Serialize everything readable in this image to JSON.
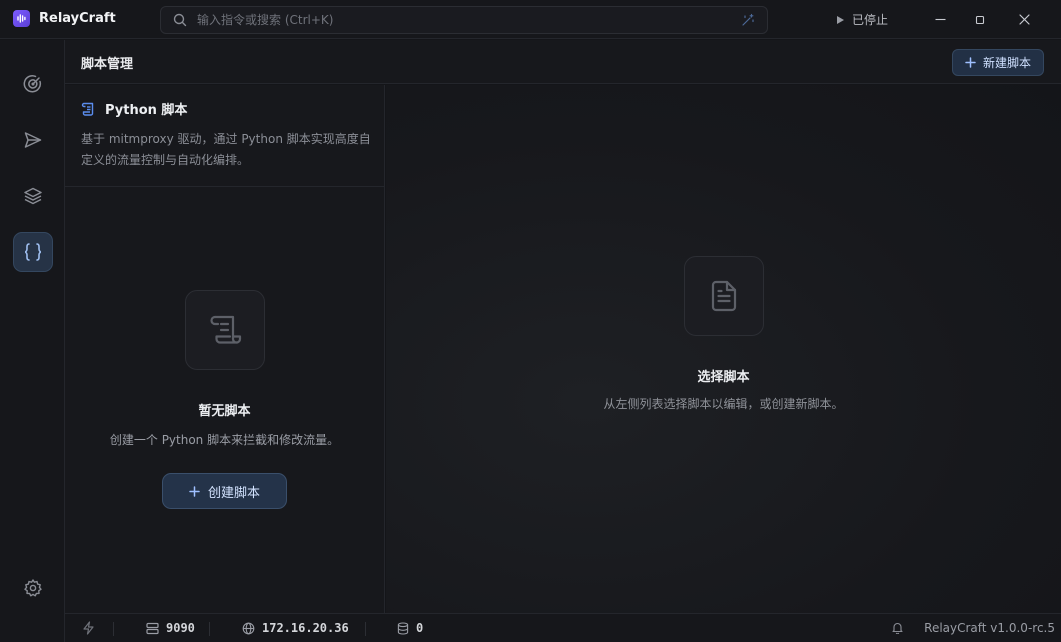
{
  "app": {
    "name": "RelayCraft"
  },
  "search": {
    "placeholder": "输入指令或搜索 (Ctrl+K)"
  },
  "proxy_status": {
    "label": "已停止"
  },
  "header": {
    "title": "脚本管理",
    "new_button": "新建脚本"
  },
  "script_panel": {
    "title": "Python 脚本",
    "description": "基于 mitmproxy 驱动，通过 Python 脚本实现高度自定义的流量控制与自动化编排。",
    "empty_title": "暂无脚本",
    "empty_desc": "创建一个 Python 脚本来拦截和修改流量。",
    "create_button": "创建脚本"
  },
  "detail_panel": {
    "empty_title": "选择脚本",
    "empty_desc": "从左侧列表选择脚本以编辑，或创建新脚本。"
  },
  "statusbar": {
    "port": "9090",
    "ip": "172.16.20.36",
    "count": "0",
    "version": "RelayCraft v1.0.0-rc.5"
  },
  "icons": {
    "brand": "audio-wave-icon",
    "nav": [
      "radar-icon",
      "send-icon",
      "layers-icon",
      "braces-icon",
      "settings-icon"
    ],
    "accent": "#5b8def"
  }
}
